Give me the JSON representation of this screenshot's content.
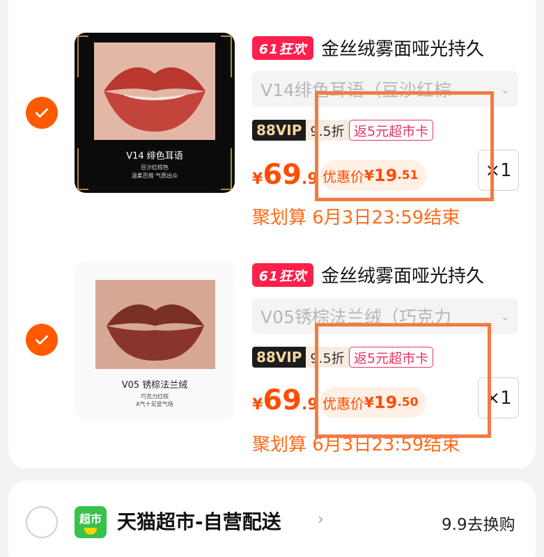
{
  "items": [
    {
      "checked": true,
      "image": {
        "caption_main": "V14 绯色耳语",
        "caption_sub_1": "豆沙红棕色",
        "caption_sub_2": "温柔百搭 气质出众"
      },
      "promo_tag": "61狂欢",
      "title": "金丝绒雾面哑光持久",
      "sku": "V14绯色耳语（豆沙红棕",
      "vip_label": "88VIP",
      "vip_discount": "9.5折",
      "rebate": "返5元超市卡",
      "price_currency": "¥",
      "price_int": "69",
      "price_dec": ".9",
      "deal_label": "优惠价",
      "deal_currency": "¥",
      "deal_int": "19",
      "deal_dec": ".51",
      "quantity": "×1",
      "juhuasuan": "聚划算 6月3日23:59结束"
    },
    {
      "checked": true,
      "image": {
        "caption_main": "V05 锈棕法兰绒",
        "caption_sub_1": "巧克力红棕",
        "caption_sub_2": "A气十足显气场"
      },
      "promo_tag": "61狂欢",
      "title": "金丝绒雾面哑光持久",
      "sku": "V05锈棕法兰绒（巧克力",
      "vip_label": "88VIP",
      "vip_discount": "9.5折",
      "rebate": "返5元超市卡",
      "price_currency": "¥",
      "price_int": "69",
      "price_dec": ".9",
      "deal_label": "优惠价",
      "deal_currency": "¥",
      "deal_int": "19",
      "deal_dec": ".50",
      "quantity": "×1",
      "juhuasuan": "聚划算 6月3日23:59结束"
    }
  ],
  "shop": {
    "logo_text": "超市",
    "name": "天猫超市-自营配送",
    "link": "9.9去换购"
  },
  "colors": {
    "accent": "#ff5a00",
    "price": "#ff4d00",
    "highlight_box": "#f47a42",
    "promo_tag": "#ff1f4b"
  }
}
